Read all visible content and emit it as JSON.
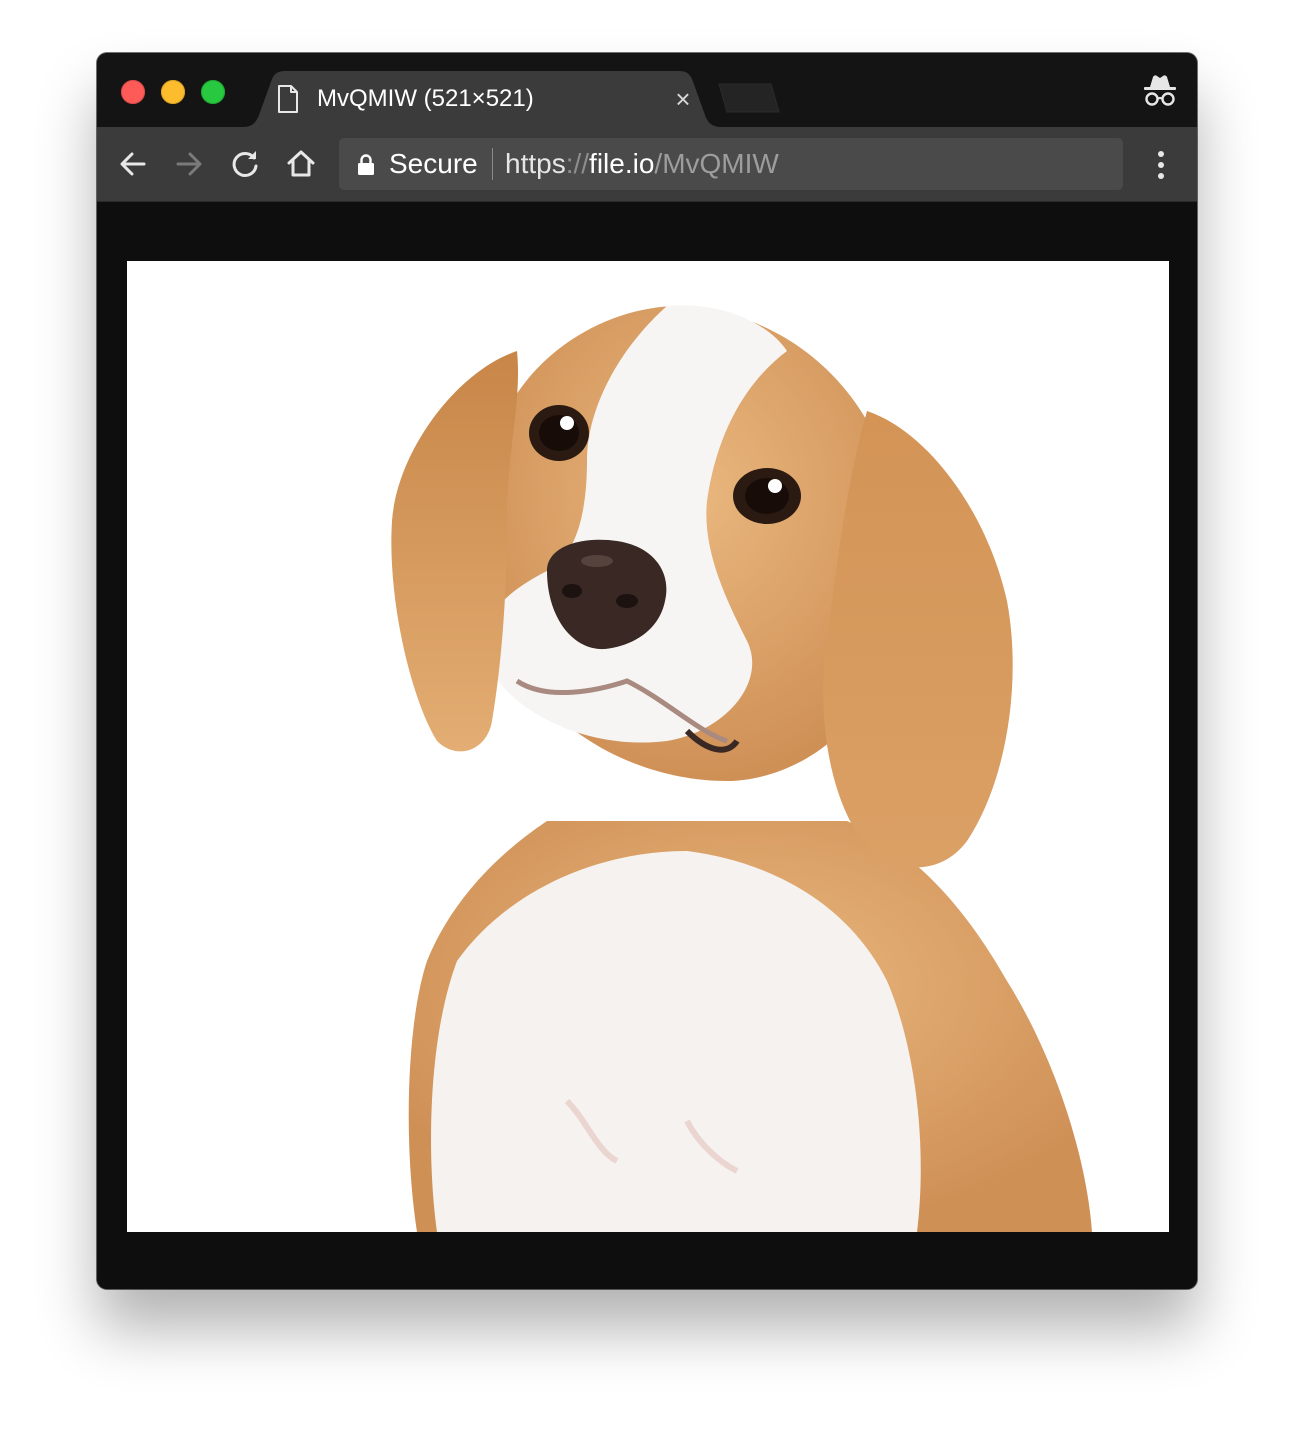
{
  "window": {
    "tab": {
      "title": "MvQMIW (521×521)",
      "close_glyph": "×",
      "icon": "document-icon"
    },
    "toolbar": {
      "back_icon": "arrow-left-icon",
      "forward_icon": "arrow-right-icon",
      "reload_icon": "reload-icon",
      "home_icon": "home-icon",
      "menu_icon": "more-vertical-icon",
      "incognito_icon": "incognito-icon"
    },
    "omnibox": {
      "secure_label": "Secure",
      "url_scheme": "https",
      "url_separator": "://",
      "url_host": "file.io",
      "url_path": "/MvQMIW"
    }
  },
  "content": {
    "image_description_icon": "beagle-photo",
    "image_size": "521×521"
  },
  "colors": {
    "traffic_close": "#fc5b57",
    "traffic_minimize": "#fdbc2e",
    "traffic_maximize": "#28c840",
    "tab_active": "#3b3b3c",
    "tabstrip": "#141415",
    "omnibox": "#4a4a4b",
    "viewport": "#0e0e0f"
  }
}
